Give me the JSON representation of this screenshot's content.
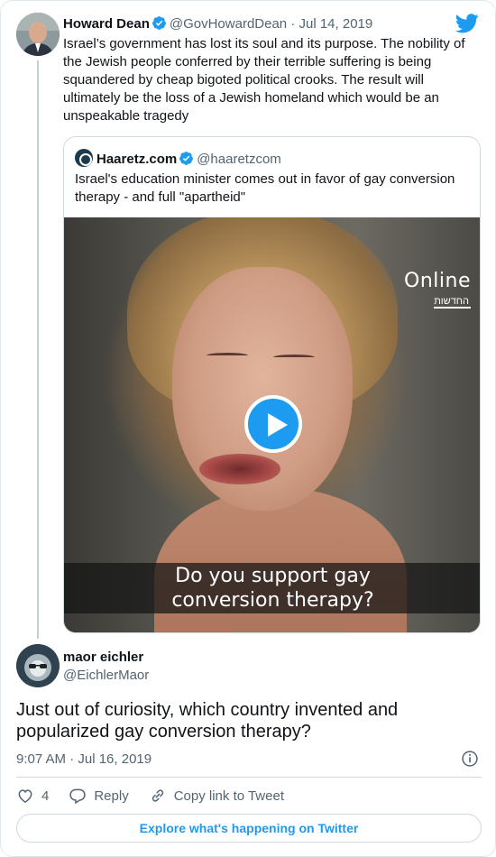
{
  "parent_tweet": {
    "author_name": "Howard Dean",
    "author_handle": "@GovHowardDean",
    "date": "· Jul 14, 2019",
    "text": "Israel’s government has lost its soul and its purpose. The nobility of the Jewish people conferred by their terrible suffering is being squandered by cheap bigoted political crooks. The result will ultimately be the loss of a Jewish homeland which would be an unspeakable tragedy"
  },
  "quoted_tweet": {
    "author_name": "Haaretz.com",
    "author_handle": "@haaretzcom",
    "text": "Israel's education minister comes out in favor of gay conversion therapy - and full \"apartheid\"",
    "video": {
      "watermark": "Online",
      "watermark_sub": "החדשות",
      "caption_line1": "Do you support gay",
      "caption_line2": "conversion therapy?"
    }
  },
  "reply_tweet": {
    "author_name": "maor eichler",
    "author_handle": "@EichlerMaor",
    "text": "Just out of curiosity, which country invented and popularized gay conversion therapy?",
    "timestamp": "9:07 AM · Jul 16, 2019",
    "likes_count": "4",
    "reply_label": "Reply",
    "copy_link_label": "Copy link to Tweet"
  },
  "footer": {
    "explore_label": "Explore what's happening on Twitter"
  },
  "colors": {
    "accent": "#1d9bf0",
    "secondary_text": "#536471",
    "border": "#cfd9de"
  },
  "icons": [
    "twitter-bird-icon",
    "verified-badge-icon",
    "play-icon",
    "info-icon",
    "heart-icon",
    "reply-icon",
    "link-icon"
  ]
}
